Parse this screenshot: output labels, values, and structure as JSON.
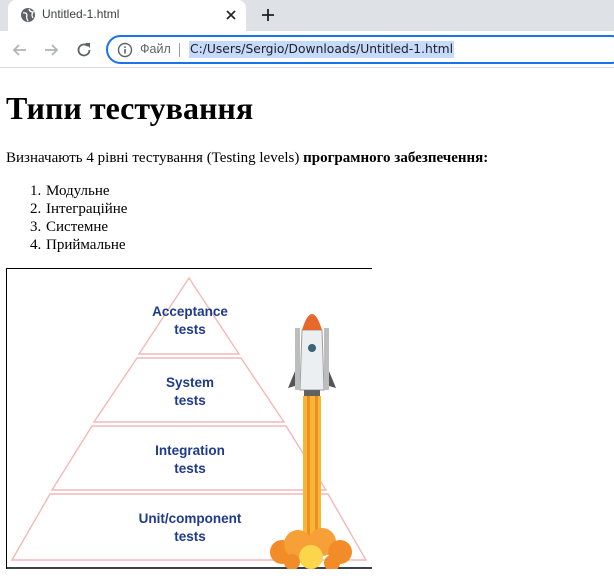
{
  "browser": {
    "tab_title": "Untitled-1.html",
    "scheme_label": "Файл",
    "url": "C:/Users/Sergio/Downloads/Untitled-1.html",
    "accent_color": "#1a73e8"
  },
  "page": {
    "title": "Типи тестування",
    "intro_text": "Визначають 4 рівні тестування (Testing levels) ",
    "intro_bold": "програмного забезпечення:",
    "levels": [
      {
        "num": "1.",
        "label": "Модульне"
      },
      {
        "num": "2.",
        "label": "Інтеграційне"
      },
      {
        "num": "3.",
        "label": "Системне"
      },
      {
        "num": "4.",
        "label": "Приймальне"
      }
    ]
  },
  "figure": {
    "pyramid_levels": [
      {
        "line1": "Acceptance",
        "line2": "tests"
      },
      {
        "line1": "System",
        "line2": "tests"
      },
      {
        "line1": "Integration",
        "line2": "tests"
      },
      {
        "line1": "Unit/component",
        "line2": "tests"
      }
    ],
    "text_color": "#1f3a8a",
    "outline_color": "#f2b8b8"
  }
}
